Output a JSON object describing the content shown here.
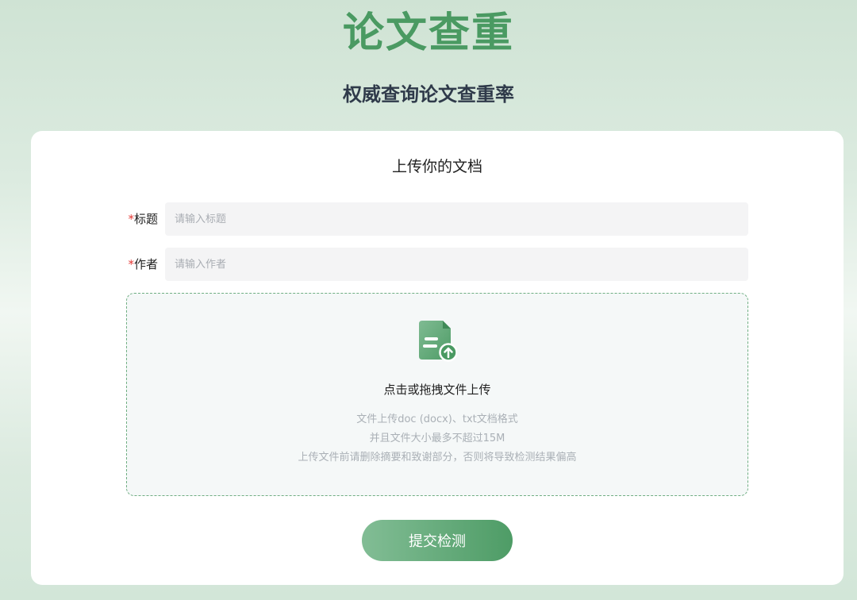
{
  "header": {
    "title": "论文查重",
    "subtitle": "权威查询论文查重率"
  },
  "card": {
    "title": "上传你的文档",
    "fields": [
      {
        "required_mark": "*",
        "label": "标题",
        "placeholder": "请输入标题",
        "value": ""
      },
      {
        "required_mark": "*",
        "label": "作者",
        "placeholder": "请输入作者",
        "value": ""
      }
    ],
    "upload": {
      "icon": "file-upload-icon",
      "title": "点击或拖拽文件上传",
      "hints": [
        "文件上传doc (docx)、txt文档格式",
        "并且文件大小最多不超过15M",
        "上传文件前请删除摘要和致谢部分，否则将导致检测结果偏高"
      ]
    },
    "submit_label": "提交检测"
  },
  "colors": {
    "accent": "#4a9a62",
    "required": "#e53935",
    "button_gradient_start": "#82bd95",
    "button_gradient_end": "#4e9c66"
  }
}
